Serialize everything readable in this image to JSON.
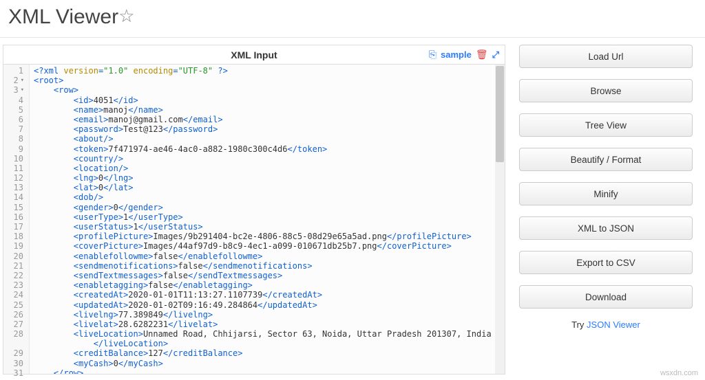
{
  "header": {
    "title": "XML Viewer",
    "star_icon": "☆"
  },
  "panel": {
    "title": "XML Input",
    "sample_label": "sample",
    "copy_icon": "⎘",
    "trash_icon": "🗑",
    "expand_icon": "⤢"
  },
  "code": {
    "lines": [
      {
        "n": 1,
        "i": 0,
        "raw": "<?xml version=\"1.0\" encoding=\"UTF-8\" ?>",
        "parts": [
          {
            "t": "tag",
            "v": "<?xml "
          },
          {
            "t": "attr",
            "v": "version"
          },
          {
            "t": "tag",
            "v": "="
          },
          {
            "t": "str",
            "v": "\"1.0\""
          },
          {
            "t": "tag",
            "v": " "
          },
          {
            "t": "attr",
            "v": "encoding"
          },
          {
            "t": "tag",
            "v": "="
          },
          {
            "t": "str",
            "v": "\"UTF-8\""
          },
          {
            "t": "tag",
            "v": " ?>"
          }
        ]
      },
      {
        "n": 2,
        "i": 0,
        "fold": true,
        "raw": "<root>",
        "parts": [
          {
            "t": "tag",
            "v": "<root>"
          }
        ]
      },
      {
        "n": 3,
        "i": 1,
        "fold": true,
        "raw": "<row>",
        "parts": [
          {
            "t": "tag",
            "v": "<row>"
          }
        ]
      },
      {
        "n": 4,
        "i": 2,
        "raw": "<id>4051</id>",
        "parts": [
          {
            "t": "tag",
            "v": "<id>"
          },
          {
            "t": "txt",
            "v": "4051"
          },
          {
            "t": "tag",
            "v": "</id>"
          }
        ]
      },
      {
        "n": 5,
        "i": 2,
        "raw": "<name>manoj</name>",
        "parts": [
          {
            "t": "tag",
            "v": "<name>"
          },
          {
            "t": "txt",
            "v": "manoj"
          },
          {
            "t": "tag",
            "v": "</name>"
          }
        ]
      },
      {
        "n": 6,
        "i": 2,
        "raw": "<email>manoj@gmail.com</email>",
        "parts": [
          {
            "t": "tag",
            "v": "<email>"
          },
          {
            "t": "txt",
            "v": "manoj@gmail.com"
          },
          {
            "t": "tag",
            "v": "</email>"
          }
        ]
      },
      {
        "n": 7,
        "i": 2,
        "raw": "<password>Test@123</password>",
        "parts": [
          {
            "t": "tag",
            "v": "<password>"
          },
          {
            "t": "txt",
            "v": "Test@123"
          },
          {
            "t": "tag",
            "v": "</password>"
          }
        ]
      },
      {
        "n": 8,
        "i": 2,
        "raw": "<about/>",
        "parts": [
          {
            "t": "tag",
            "v": "<about/>"
          }
        ]
      },
      {
        "n": 9,
        "i": 2,
        "raw": "<token>7f471974-ae46-4ac0-a882-1980c300c4d6</token>",
        "parts": [
          {
            "t": "tag",
            "v": "<token>"
          },
          {
            "t": "txt",
            "v": "7f471974-ae46-4ac0-a882-1980c300c4d6"
          },
          {
            "t": "tag",
            "v": "</token>"
          }
        ]
      },
      {
        "n": 10,
        "i": 2,
        "raw": "<country/>",
        "parts": [
          {
            "t": "tag",
            "v": "<country/>"
          }
        ]
      },
      {
        "n": 11,
        "i": 2,
        "raw": "<location/>",
        "parts": [
          {
            "t": "tag",
            "v": "<location/>"
          }
        ]
      },
      {
        "n": 12,
        "i": 2,
        "raw": "<lng>0</lng>",
        "parts": [
          {
            "t": "tag",
            "v": "<lng>"
          },
          {
            "t": "txt",
            "v": "0"
          },
          {
            "t": "tag",
            "v": "</lng>"
          }
        ]
      },
      {
        "n": 13,
        "i": 2,
        "raw": "<lat>0</lat>",
        "parts": [
          {
            "t": "tag",
            "v": "<lat>"
          },
          {
            "t": "txt",
            "v": "0"
          },
          {
            "t": "tag",
            "v": "</lat>"
          }
        ]
      },
      {
        "n": 14,
        "i": 2,
        "raw": "<dob/>",
        "parts": [
          {
            "t": "tag",
            "v": "<dob/>"
          }
        ]
      },
      {
        "n": 15,
        "i": 2,
        "raw": "<gender>0</gender>",
        "parts": [
          {
            "t": "tag",
            "v": "<gender>"
          },
          {
            "t": "txt",
            "v": "0"
          },
          {
            "t": "tag",
            "v": "</gender>"
          }
        ]
      },
      {
        "n": 16,
        "i": 2,
        "raw": "<userType>1</userType>",
        "parts": [
          {
            "t": "tag",
            "v": "<userType>"
          },
          {
            "t": "txt",
            "v": "1"
          },
          {
            "t": "tag",
            "v": "</userType>"
          }
        ]
      },
      {
        "n": 17,
        "i": 2,
        "raw": "<userStatus>1</userStatus>",
        "parts": [
          {
            "t": "tag",
            "v": "<userStatus>"
          },
          {
            "t": "txt",
            "v": "1"
          },
          {
            "t": "tag",
            "v": "</userStatus>"
          }
        ]
      },
      {
        "n": 18,
        "i": 2,
        "raw": "<profilePicture>Images/9b291404-bc2e-4806-88c5-08d29e65a5ad.png</profilePicture>",
        "parts": [
          {
            "t": "tag",
            "v": "<profilePicture>"
          },
          {
            "t": "txt",
            "v": "Images/9b291404-bc2e-4806-88c5-08d29e65a5ad.png"
          },
          {
            "t": "tag",
            "v": "</profilePicture>"
          }
        ]
      },
      {
        "n": 19,
        "i": 2,
        "raw": "<coverPicture>Images/44af97d9-b8c9-4ec1-a099-010671db25b7.png</coverPicture>",
        "parts": [
          {
            "t": "tag",
            "v": "<coverPicture>"
          },
          {
            "t": "txt",
            "v": "Images/44af97d9-b8c9-4ec1-a099-010671db25b7.png"
          },
          {
            "t": "tag",
            "v": "</coverPicture>"
          }
        ]
      },
      {
        "n": 20,
        "i": 2,
        "raw": "<enablefollowme>false</enablefollowme>",
        "parts": [
          {
            "t": "tag",
            "v": "<enablefollowme>"
          },
          {
            "t": "txt",
            "v": "false"
          },
          {
            "t": "tag",
            "v": "</enablefollowme>"
          }
        ]
      },
      {
        "n": 21,
        "i": 2,
        "raw": "<sendmenotifications>false</sendmenotifications>",
        "parts": [
          {
            "t": "tag",
            "v": "<sendmenotifications>"
          },
          {
            "t": "txt",
            "v": "false"
          },
          {
            "t": "tag",
            "v": "</sendmenotifications>"
          }
        ]
      },
      {
        "n": 22,
        "i": 2,
        "raw": "<sendTextmessages>false</sendTextmessages>",
        "parts": [
          {
            "t": "tag",
            "v": "<sendTextmessages>"
          },
          {
            "t": "txt",
            "v": "false"
          },
          {
            "t": "tag",
            "v": "</sendTextmessages>"
          }
        ]
      },
      {
        "n": 23,
        "i": 2,
        "raw": "<enabletagging>false</enabletagging>",
        "parts": [
          {
            "t": "tag",
            "v": "<enabletagging>"
          },
          {
            "t": "txt",
            "v": "false"
          },
          {
            "t": "tag",
            "v": "</enabletagging>"
          }
        ]
      },
      {
        "n": 24,
        "i": 2,
        "raw": "<createdAt>2020-01-01T11:13:27.1107739</createdAt>",
        "parts": [
          {
            "t": "tag",
            "v": "<createdAt>"
          },
          {
            "t": "txt",
            "v": "2020-01-01T11:13:27.1107739"
          },
          {
            "t": "tag",
            "v": "</createdAt>"
          }
        ]
      },
      {
        "n": 25,
        "i": 2,
        "raw": "<updatedAt>2020-01-02T09:16:49.284864</updatedAt>",
        "parts": [
          {
            "t": "tag",
            "v": "<updatedAt>"
          },
          {
            "t": "txt",
            "v": "2020-01-02T09:16:49.284864"
          },
          {
            "t": "tag",
            "v": "</updatedAt>"
          }
        ]
      },
      {
        "n": 26,
        "i": 2,
        "raw": "<livelng>77.389849</livelng>",
        "parts": [
          {
            "t": "tag",
            "v": "<livelng>"
          },
          {
            "t": "txt",
            "v": "77.389849"
          },
          {
            "t": "tag",
            "v": "</livelng>"
          }
        ]
      },
      {
        "n": 27,
        "i": 2,
        "raw": "<livelat>28.6282231</livelat>",
        "parts": [
          {
            "t": "tag",
            "v": "<livelat>"
          },
          {
            "t": "txt",
            "v": "28.6282231"
          },
          {
            "t": "tag",
            "v": "</livelat>"
          }
        ]
      },
      {
        "n": 28,
        "i": 2,
        "raw": "<liveLocation>Unnamed Road, Chhijarsi, Sector 63, Noida, Uttar Pradesh 201307, India",
        "parts": [
          {
            "t": "tag",
            "v": "<liveLocation>"
          },
          {
            "t": "txt",
            "v": "Unnamed Road, Chhijarsi, Sector 63, Noida, Uttar Pradesh 201307, India"
          }
        ]
      },
      {
        "n": "",
        "i": 3,
        "raw": "</liveLocation>",
        "parts": [
          {
            "t": "tag",
            "v": "</liveLocation>"
          }
        ]
      },
      {
        "n": 29,
        "i": 2,
        "raw": "<creditBalance>127</creditBalance>",
        "parts": [
          {
            "t": "tag",
            "v": "<creditBalance>"
          },
          {
            "t": "txt",
            "v": "127"
          },
          {
            "t": "tag",
            "v": "</creditBalance>"
          }
        ]
      },
      {
        "n": 30,
        "i": 2,
        "raw": "<myCash>0</myCash>",
        "parts": [
          {
            "t": "tag",
            "v": "<myCash>"
          },
          {
            "t": "txt",
            "v": "0"
          },
          {
            "t": "tag",
            "v": "</myCash>"
          }
        ]
      },
      {
        "n": 31,
        "i": 1,
        "raw": "</row>",
        "parts": [
          {
            "t": "tag",
            "v": "</row>"
          }
        ]
      }
    ]
  },
  "sidebar": {
    "buttons": [
      "Load Url",
      "Browse",
      "Tree View",
      "Beautify / Format",
      "Minify",
      "XML to JSON",
      "Export to CSV",
      "Download"
    ],
    "try_text": "Try ",
    "try_link": "JSON Viewer"
  },
  "footer": "wsxdn.com"
}
